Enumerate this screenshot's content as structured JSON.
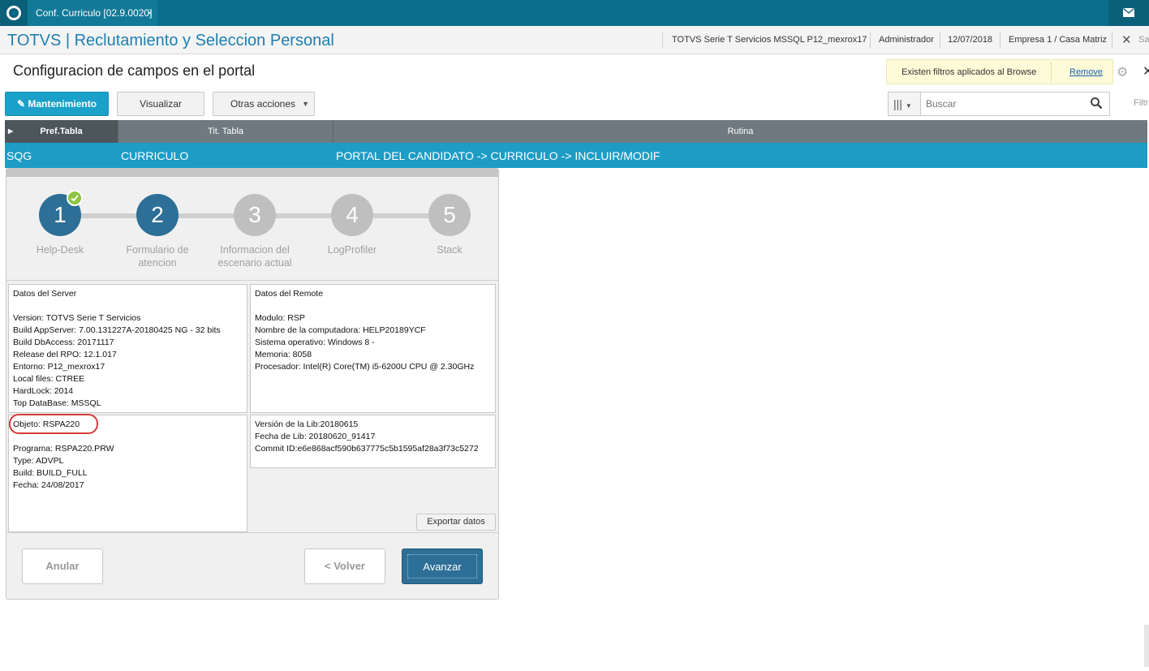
{
  "topbar": {
    "tab_label": "Conf. Curriculo [02.9.0020]",
    "tab_close": "×",
    "mail_icon": "mail-icon"
  },
  "header": {
    "app_title": "TOTVS | Reclutamiento y Seleccion Personal",
    "server": "TOTVS Serie T Servicios MSSQL P12_mexrox17",
    "user": "Administrador",
    "date": "12/07/2018",
    "company": "Empresa 1 / Casa Matriz",
    "close": "✕",
    "trailing": "Sa"
  },
  "page": {
    "title": "Configuracion de campos en el portal",
    "filter_note": "Existen filtros aplicados al Browse",
    "filter_remove": "Remove"
  },
  "toolbar": {
    "maintenance": "Mantenimiento",
    "view": "Visualizar",
    "other_actions": "Otras acciones",
    "search_placeholder": "Buscar",
    "filter_label": "Filtr"
  },
  "table": {
    "headers": [
      "Pref.Tabla",
      "Tit. Tabla",
      "Rutina"
    ],
    "rows": [
      [
        "SQG",
        "CURRICULO",
        "PORTAL DEL CANDIDATO -> CURRICULO -> INCLUIR/MODIF"
      ]
    ]
  },
  "wizard": {
    "steps": [
      {
        "number": "1",
        "label_1": "Help-Desk",
        "label_2": ""
      },
      {
        "number": "2",
        "label_1": "Formulario de",
        "label_2": "atencion"
      },
      {
        "number": "3",
        "label_1": "Informacion del",
        "label_2": "escenario actual"
      },
      {
        "number": "4",
        "label_1": "LogProfiler",
        "label_2": ""
      },
      {
        "number": "5",
        "label_1": "Stack",
        "label_2": ""
      }
    ],
    "server_panel": {
      "title": "Datos del Server",
      "lines": [
        "Version: TOTVS Serie T Servicios",
        "Build AppServer: 7.00.131227A-20180425 NG - 32 bits",
        "Build DbAccess: 20171117",
        "Release del RPO:  12.1.017",
        "Entorno: P12_mexrox17",
        "Local files: CTREE",
        "HardLock: 2014",
        "Top DataBase: MSSQL"
      ]
    },
    "remote_panel": {
      "title": "Datos del Remote",
      "lines": [
        "Modulo: RSP",
        "Nombre de la computadora: HELP20189YCF",
        "Sistema operativo: Windows 8 -",
        "Memoria: 8058",
        "Procesador: Intel(R) Core(TM) i5-6200U CPU @ 2.30GHz"
      ]
    },
    "object_panel": {
      "title": "Objeto: RSPA220",
      "lines": [
        "Programa: RSPA220.PRW",
        "Type: ADVPL",
        "Build: BUILD_FULL",
        "Fecha: 24/08/2017"
      ]
    },
    "lib_panel": {
      "lines": [
        "Versión de la Lib:20180615",
        "Fecha de Lib: 20180620_91417",
        "Commit ID:e6e868acf590b637775c5b1595af28a3f73c5272"
      ]
    },
    "export_button": "Exportar datos",
    "cancel_button": "Anular",
    "back_button": "< Volver",
    "next_button": "Avanzar"
  },
  "colors": {
    "topbar": "#0b6e8c",
    "primary": "#1aa0c9",
    "step_active": "#2d6f96",
    "step_inactive": "#bfbfbf",
    "check": "#8dc63f",
    "highlight": "#d63a3a"
  }
}
